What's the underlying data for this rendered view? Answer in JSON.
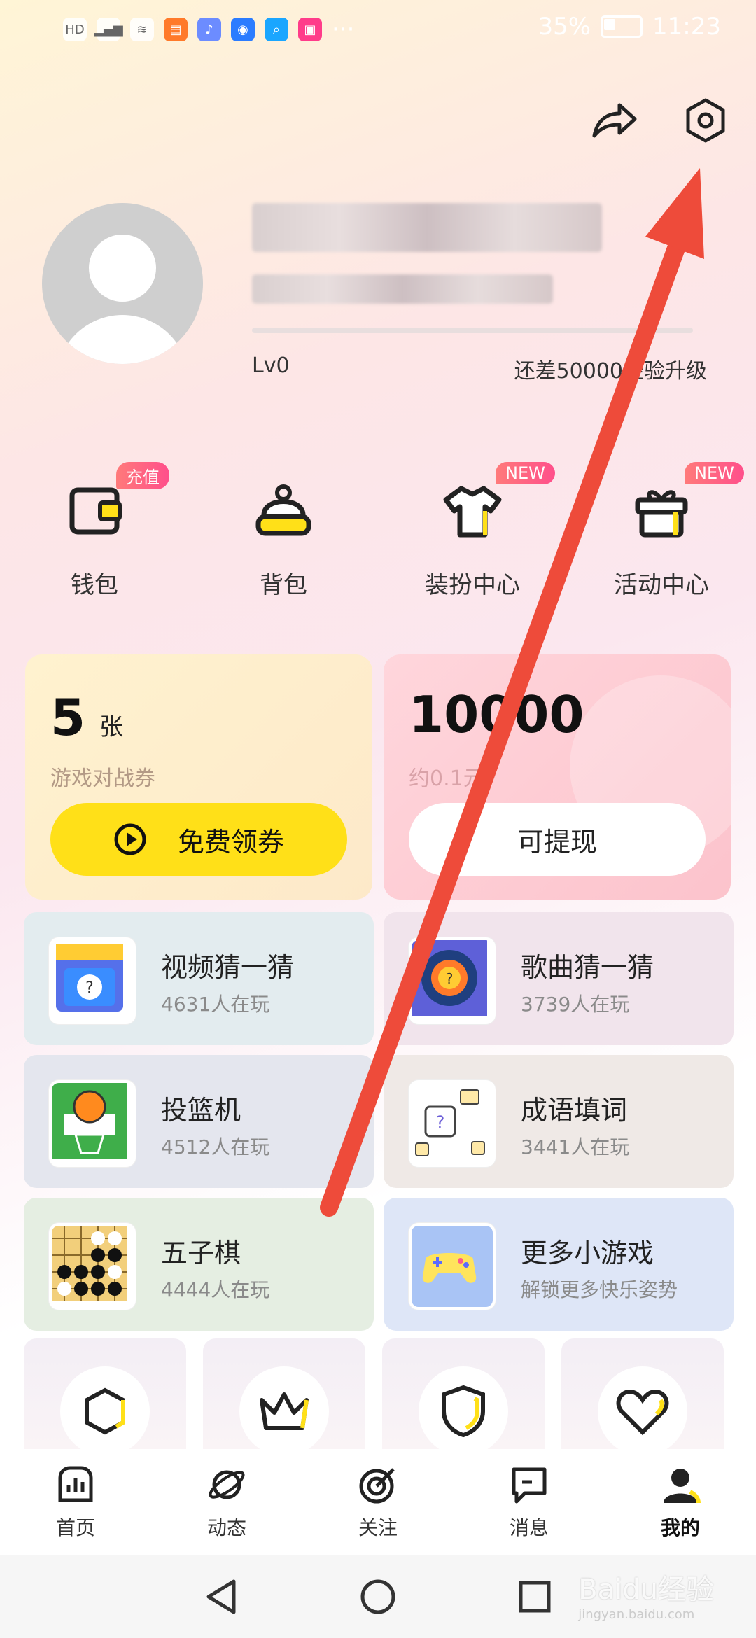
{
  "status_bar": {
    "battery": "35%",
    "battery_level": 0.35,
    "time": "11:23",
    "left_dots": "···"
  },
  "profile": {
    "level": "Lv0",
    "exp_hint": "还差50000经验升级"
  },
  "quick_entries": [
    {
      "label": "钱包",
      "badge": "充值",
      "icon": "wallet-icon"
    },
    {
      "label": "背包",
      "badge": "",
      "icon": "backpack-icon"
    },
    {
      "label": "装扮中心",
      "badge": "NEW",
      "icon": "shirt-icon"
    },
    {
      "label": "活动中心",
      "badge": "NEW",
      "icon": "gift-icon"
    }
  ],
  "coupon_card": {
    "count": "5",
    "unit": "张",
    "desc": "游戏对战券",
    "button": "免费领券"
  },
  "cash_card": {
    "amount": "10000",
    "desc": "约0.1元",
    "button": "可提现"
  },
  "games": [
    {
      "title": "视频猜一猜",
      "players": "4631人在玩",
      "icon": "video-guess-icon",
      "bg": "#e3ecef"
    },
    {
      "title": "歌曲猜一猜",
      "players": "3739人在玩",
      "icon": "song-guess-icon",
      "bg": "#f1e4ec"
    },
    {
      "title": "投篮机",
      "players": "4512人在玩",
      "icon": "basketball-icon",
      "bg": "#e4e6ee"
    },
    {
      "title": "成语填词",
      "players": "3441人在玩",
      "icon": "idiom-icon",
      "bg": "#efe9e6"
    },
    {
      "title": "五子棋",
      "players": "4444人在玩",
      "icon": "gomoku-icon",
      "bg": "#e5eee2"
    },
    {
      "title": "更多小游戏",
      "players": "解锁更多快乐姿势",
      "icon": "gamepad-icon",
      "bg": "#dee6f7"
    }
  ],
  "tabs": [
    {
      "label": "首页",
      "icon": "home-chart-icon"
    },
    {
      "label": "动态",
      "icon": "planet-icon"
    },
    {
      "label": "关注",
      "icon": "target-icon"
    },
    {
      "label": "消息",
      "icon": "message-icon"
    },
    {
      "label": "我的",
      "icon": "profile-icon",
      "active": true
    }
  ],
  "watermark": {
    "text": "Baidu经验",
    "sub": "jingyan.baidu.com"
  },
  "colors": {
    "accent": "#ffe018",
    "arrow": "#ee4b3a"
  }
}
